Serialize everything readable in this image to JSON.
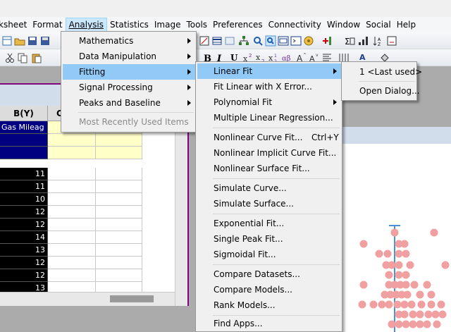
{
  "menubar": {
    "items": [
      {
        "id": "worksheet",
        "label": "ksheet",
        "ul": ""
      },
      {
        "id": "format",
        "label": "Format",
        "ul": "Format"
      },
      {
        "id": "analysis",
        "label": "Analysis",
        "ul": "Analysis"
      },
      {
        "id": "statistics",
        "label": "Statistics",
        "ul": "Statistics"
      },
      {
        "id": "image",
        "label": "Image",
        "ul": "Image"
      },
      {
        "id": "tools",
        "label": "Tools",
        "ul": "Tools"
      },
      {
        "id": "preferences",
        "label": "Preferences",
        "ul": "Preferences"
      },
      {
        "id": "connectivity",
        "label": "Connectivity",
        "ul": "Connectivity"
      },
      {
        "id": "window",
        "label": "Window",
        "ul": "Window"
      },
      {
        "id": "social",
        "label": "Social",
        "ul": "Social"
      },
      {
        "id": "help",
        "label": "Help",
        "ul": "Help"
      }
    ]
  },
  "analysis_menu": {
    "items": [
      {
        "label": "Mathematics"
      },
      {
        "label": "Data Manipulation"
      },
      {
        "label": "Fitting"
      },
      {
        "label": "Signal Processing"
      },
      {
        "label": "Peaks and Baseline"
      },
      {
        "label": "Most Recently Used Items"
      }
    ]
  },
  "fitting_menu": {
    "items": [
      {
        "label": "Linear Fit"
      },
      {
        "label": "Fit Linear with X Error..."
      },
      {
        "label": "Polynomial Fit"
      },
      {
        "label": "Multiple Linear Regression..."
      },
      {
        "label": "Nonlinear Curve Fit...",
        "shortcut": "Ctrl+Y"
      },
      {
        "label": "Nonlinear Implicit Curve Fit..."
      },
      {
        "label": "Nonlinear Surface Fit..."
      },
      {
        "label": "Simulate Curve..."
      },
      {
        "label": "Simulate Surface..."
      },
      {
        "label": "Exponential Fit..."
      },
      {
        "label": "Single Peak Fit..."
      },
      {
        "label": "Sigmoidal Fit..."
      },
      {
        "label": "Compare Datasets..."
      },
      {
        "label": "Compare Models..."
      },
      {
        "label": "Rank Models..."
      },
      {
        "label": "Find Apps..."
      }
    ]
  },
  "linear_fit_menu": {
    "items": [
      {
        "label": "1 <Last used>"
      },
      {
        "label": "Open Dialog..."
      }
    ]
  },
  "worksheet": {
    "column_header": "B(Y)",
    "column_header_c": "C",
    "long_name": "Gas Mileag",
    "values": [
      "11",
      "11",
      "10",
      "12",
      "12",
      "14",
      "13",
      "12",
      "12",
      "13",
      "13"
    ]
  },
  "colors": {
    "menu_highlight": "#91c9f7",
    "workbook_border": "#800080",
    "scatter_points": "#f0a0a0",
    "box_line": "#4a90d9"
  }
}
